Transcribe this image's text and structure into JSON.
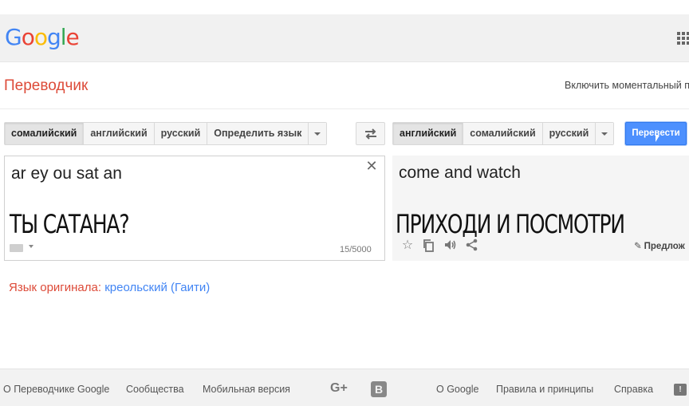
{
  "header": {
    "logo_letters": [
      {
        "ch": "G",
        "color": "#4285f4"
      },
      {
        "ch": "o",
        "color": "#ea4335"
      },
      {
        "ch": "o",
        "color": "#fbbc05"
      },
      {
        "ch": "g",
        "color": "#4285f4"
      },
      {
        "ch": "l",
        "color": "#34a853"
      },
      {
        "ch": "e",
        "color": "#ea4335"
      }
    ],
    "apps_icon": "apps-grid-icon"
  },
  "subhead": {
    "title": "Переводчик",
    "instant_toggle": "Включить моментальный п"
  },
  "source_langs": {
    "items": [
      "сомалийский",
      "английский",
      "русский",
      "Определить язык"
    ],
    "active_index": 0
  },
  "target_langs": {
    "items": [
      "английский",
      "сомалийский",
      "русский"
    ],
    "active_index": 0
  },
  "translate_button": "Перевести",
  "source": {
    "text": "ar ey ou sat an",
    "char_count": "15/5000",
    "clear_icon": "✕"
  },
  "target": {
    "text": "come and watch",
    "suggest": "Предлож",
    "tools": [
      "star-icon",
      "copy-icon",
      "speaker-icon",
      "share-icon"
    ]
  },
  "captions": {
    "left": "ТЫ САТАНА?",
    "right": "ПРИХОДИ И ПОСМОТРИ"
  },
  "detected": {
    "label": "Язык оригинала: ",
    "value": "креольский (Гаити)"
  },
  "footer": {
    "links_left": [
      "О Переводчике Google",
      "Сообщества",
      "Мобильная версия"
    ],
    "gplus": "G+",
    "blogger": "B",
    "links_right": [
      "О Google",
      "Правила и принципы",
      "Справка"
    ]
  },
  "colors": {
    "title_red": "#dd4b39",
    "link_blue": "#4285f4",
    "button_blue": "#4d90fe"
  }
}
